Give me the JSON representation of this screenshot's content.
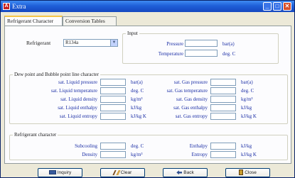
{
  "window": {
    "title": "Extra",
    "app_icon_text": "A",
    "min_glyph": "_",
    "max_glyph": "□",
    "close_glyph": "✕"
  },
  "tabs": [
    {
      "label": "Refrigerant Character",
      "active": true
    },
    {
      "label": "Conversion Tables",
      "active": false
    }
  ],
  "refrigerant": {
    "label": "Refrigerant",
    "selected": "R134a",
    "arrow": "▼"
  },
  "input": {
    "title": "Input",
    "pressure_label": "Pressure",
    "pressure_unit": "bar(a)",
    "temperature_label": "Temperature",
    "temperature_unit": "deg. C"
  },
  "dewbubble": {
    "title": "Dew point and Bubble point line character",
    "liquid": [
      {
        "label": "sat. Liquid pressure",
        "unit": "bar(a)"
      },
      {
        "label": "sat. Liquid temperature",
        "unit": "deg. C"
      },
      {
        "label": "sat. Liquid density",
        "unit": "kg/m³"
      },
      {
        "label": "sat. Liquid enthalpy",
        "unit": "kJ/kg"
      },
      {
        "label": "sat. Liquid entropy",
        "unit": "kJ/kg K"
      }
    ],
    "gas": [
      {
        "label": "sat. Gas pressure",
        "unit": "bar(a)"
      },
      {
        "label": "sat. Gas temperature",
        "unit": "deg. C"
      },
      {
        "label": "sat. Gas density",
        "unit": "kg/m³"
      },
      {
        "label": "sat. Gas enthalpy",
        "unit": "kJ/kg"
      },
      {
        "label": "sat. Gas entropy",
        "unit": "kJ/kg K"
      }
    ]
  },
  "refchar": {
    "title": "Refrigerant character",
    "subcooling_label": "Subcooling",
    "subcooling_unit": "deg. C",
    "density_label": "Density",
    "density_unit": "kg/m³",
    "enthalpy_label": "Enthalpy",
    "enthalpy_unit": "kJ/kg",
    "entropy_label": "Entropy",
    "entropy_unit": "kJ/kg K"
  },
  "buttons": {
    "inquiry": "Inquiry",
    "clear": "Clear",
    "back": "Back",
    "close": "Close"
  },
  "colors": {
    "label_blue": "#1c2fa6",
    "titlebar": "#1f5fd8",
    "panel_bg": "#fcfcfe"
  }
}
